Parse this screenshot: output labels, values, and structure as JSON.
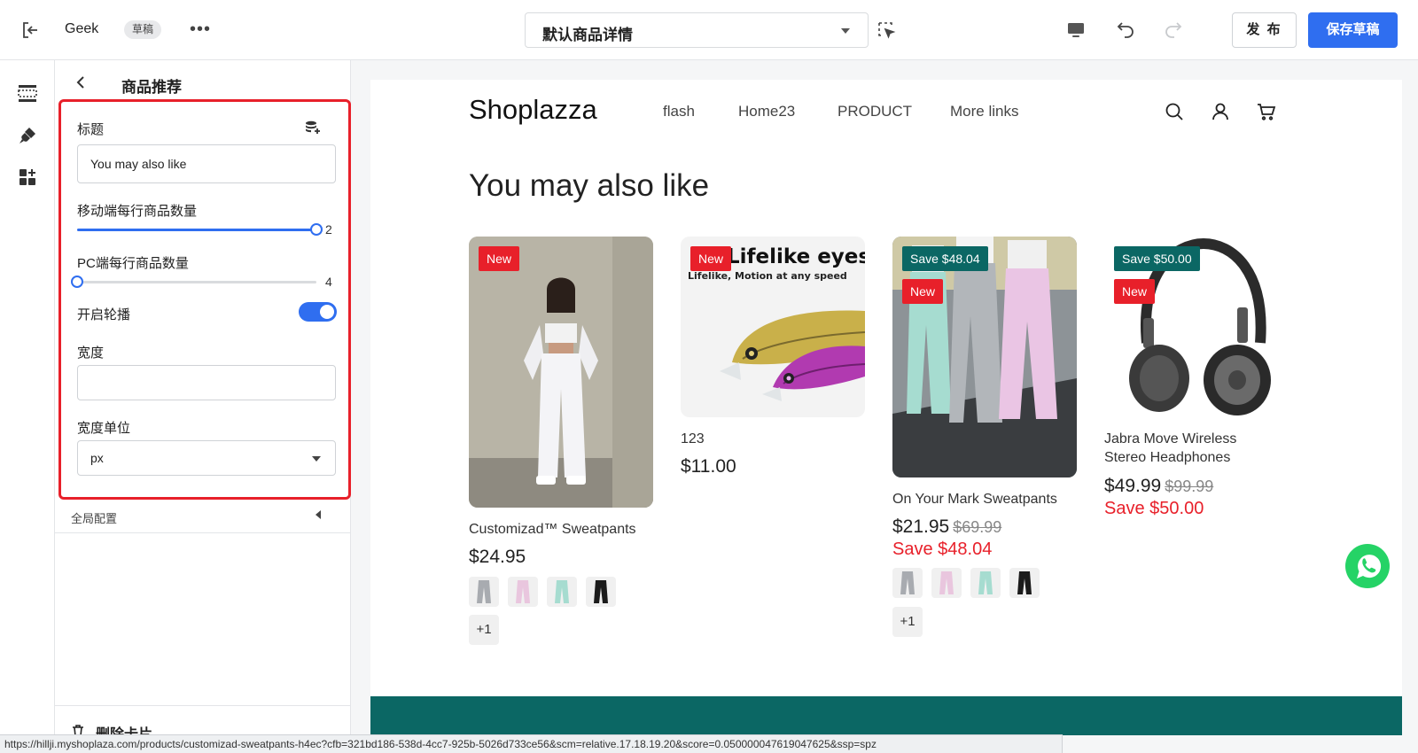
{
  "topbar": {
    "store_name": "Geek",
    "status_badge": "草稿",
    "more_glyph": "•••",
    "template_select": "默认商品详情",
    "publish_label": "发 布",
    "save_label": "保存草稿",
    "icons": [
      "exit-icon",
      "select-element-icon",
      "desktop-icon",
      "undo-icon",
      "redo-icon"
    ]
  },
  "rail": {
    "icons": [
      "sections-icon",
      "theme-brush-icon",
      "add-block-icon"
    ]
  },
  "panel": {
    "title": "商品推荐",
    "fields": {
      "title_label": "标题",
      "title_value": "You may also like",
      "mobile_label": "移动端每行商品数量",
      "mobile_value": "2",
      "pc_label": "PC端每行商品数量",
      "pc_value": "4",
      "carousel_label": "开启轮播",
      "carousel_on": true,
      "width_label": "宽度",
      "width_value": "",
      "width_unit_label": "宽度单位",
      "width_unit_value": "px"
    },
    "global_config": "全局配置",
    "delete_label": "删除卡片",
    "highlight_color": "#e8202a"
  },
  "store": {
    "logo": "Shoplazza",
    "nav": [
      "flash",
      "Home23",
      "PRODUCT",
      "More links"
    ],
    "section_title": "You may also like",
    "products": [
      {
        "name": "Customizad™ Sweatpants",
        "price": "$24.95",
        "badges": [
          "New"
        ],
        "more": "+1"
      },
      {
        "name": "123",
        "price": "$11.00",
        "badges": [
          "New"
        ],
        "image_headline": "Lifelike eyes",
        "image_sub": "Lifelike, Motion at any speed"
      },
      {
        "name": "On Your Mark Sweatpants",
        "price": "$21.95",
        "old_price": "$69.99",
        "save": "Save $48.04",
        "badges": [
          "Save $48.04",
          "New"
        ],
        "more": "+1"
      },
      {
        "name": "Jabra Move Wireless Stereo Headphones",
        "price": "$49.99",
        "old_price": "$99.99",
        "save": "Save $50.00",
        "badges": [
          "Save $50.00",
          "New"
        ]
      }
    ],
    "accent_color": "#0b6764",
    "sale_color": "#e8202a"
  },
  "statusbar": {
    "url": "https://hillji.myshoplaza.com/products/customizad-sweatpants-h4ec?cfb=321bd186-538d-4cc7-925b-5026d733ce56&scm=relative.17.18.19.20&score=0.050000047619047625&ssp=spz"
  }
}
